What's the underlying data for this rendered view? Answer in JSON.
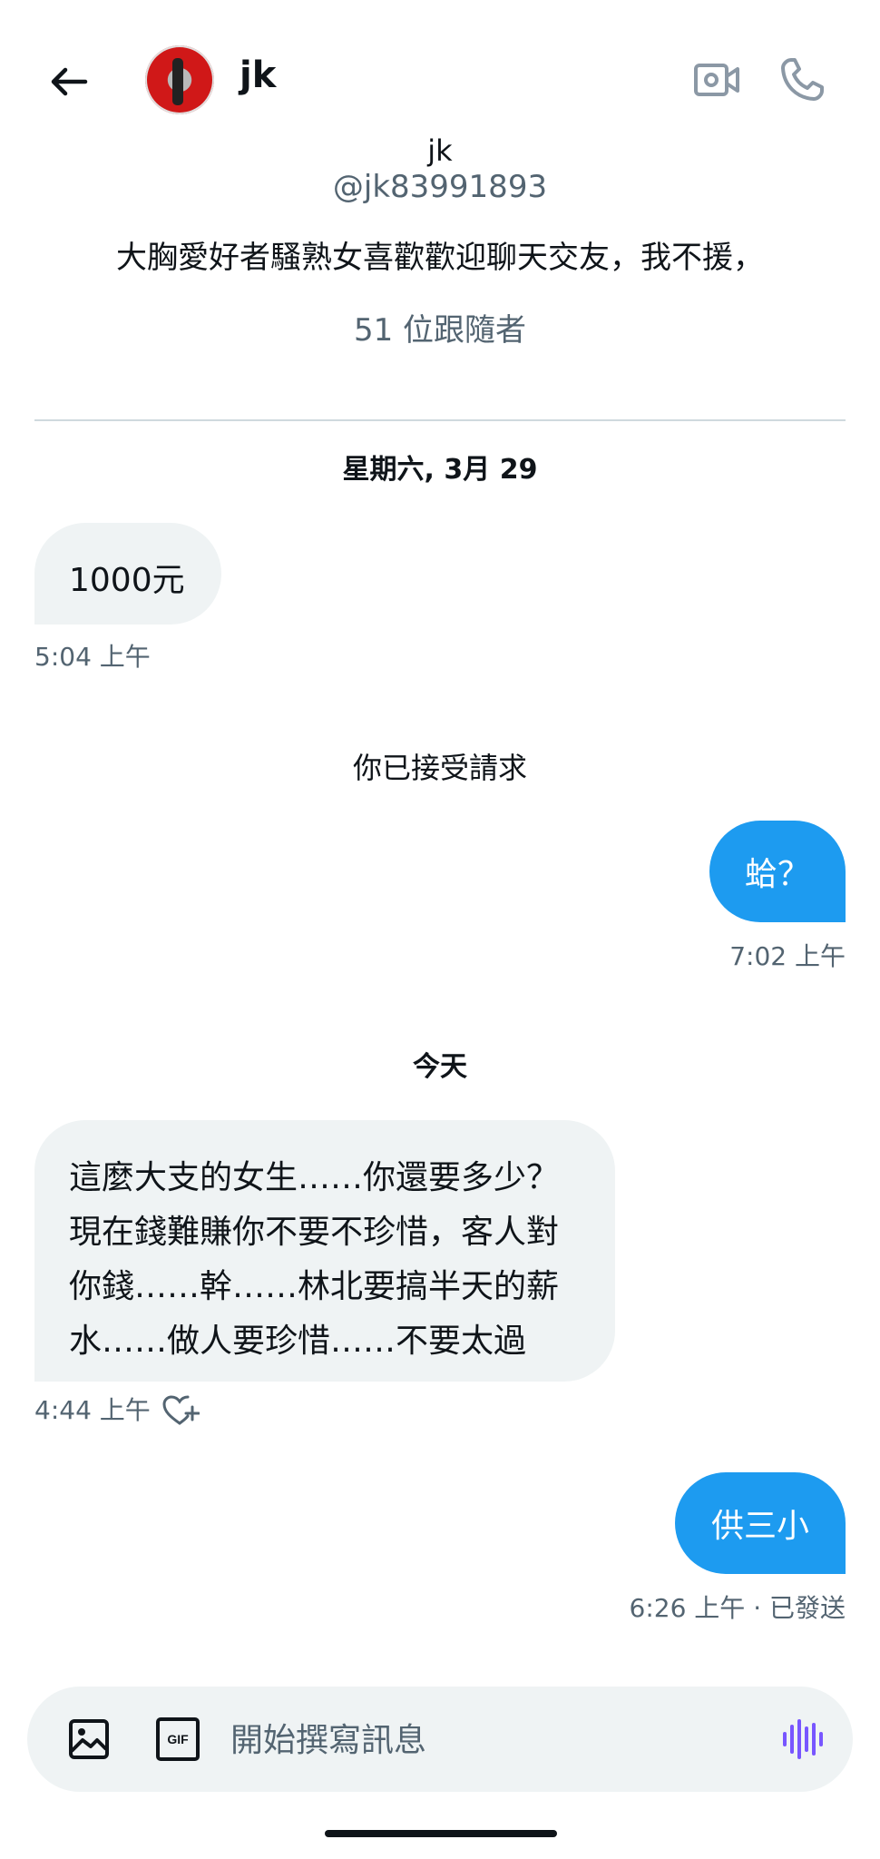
{
  "header": {
    "name": "jk"
  },
  "profile": {
    "display_name": "jk",
    "handle": "@jk83991893",
    "bio": "大胸愛好者騷熟女喜歡歡迎聊天交友，我不援，",
    "followers": "51 位跟隨者"
  },
  "conversation": {
    "date1": "星期六, 3月 29",
    "msg1": {
      "text": "1000元",
      "time": "5:04 上午"
    },
    "system": "你已接受請求",
    "msg2": {
      "text": "蛤？",
      "time": "7:02 上午"
    },
    "date2": "今天",
    "msg3": {
      "lines": [
        "這麼大支的女生……你還要多少？",
        "現在錢難賺你不要不珍惜，客人對",
        "你錢……幹……林北要搞半天的薪",
        "水……做人要珍惜……不要太過"
      ],
      "time": "4:44 上午"
    },
    "msg4": {
      "text": "供三小",
      "time": "6:26 上午 · 已發送"
    }
  },
  "composer": {
    "placeholder": "開始撰寫訊息",
    "gif_label": "GIF"
  },
  "colors": {
    "accent": "#1d9bf0",
    "received_bubble": "#eff3f4",
    "secondary_text": "#536471",
    "voice_icon": "#7856ff"
  }
}
